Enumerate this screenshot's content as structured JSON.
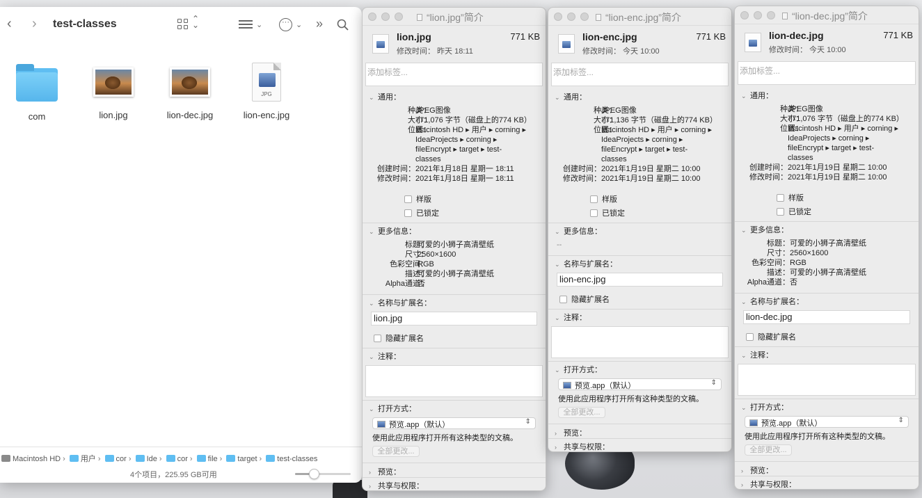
{
  "finder": {
    "title": "test-classes",
    "back_icon": "chevron-left",
    "forward_icon": "chevron-right",
    "more_overflow": "»",
    "search_icon": "magnifier",
    "items": [
      {
        "name": "com",
        "kind": "folder"
      },
      {
        "name": "lion.jpg",
        "kind": "image"
      },
      {
        "name": "lion-dec.jpg",
        "kind": "image"
      },
      {
        "name": "lion-enc.jpg",
        "kind": "jpg-doc",
        "badge": "JPG"
      }
    ],
    "path": [
      "Macintosh HD",
      "用户",
      "cor",
      "Ide",
      "cor",
      "file",
      "target",
      "test-classes"
    ],
    "status": "4个项目，225.95 GB可用",
    "icon_size_slider": 0.3
  },
  "info_windows": [
    {
      "title": "“lion.jpg”简介",
      "name": "lion.jpg",
      "size": "771 KB",
      "modified_short": "修改时间：  昨天 18:11",
      "tags_placeholder": "添加标签...",
      "general_label": "通用：",
      "general": {
        "kind_k": "种类：",
        "kind_v": "JPEG图像",
        "size_k": "大小：",
        "size_v": "771,076 字节（磁盘上的774 KB）",
        "where_k": "位置：",
        "where_v1": "Macintosh HD ▸ 用户 ▸ corning ▸",
        "where_v2": "IdeaProjects ▸ corning ▸",
        "where_v3": "fileEncrypt ▸ target ▸ test-",
        "where_v4": "classes",
        "created_k": "创建时间：",
        "created_v": "2021年1月18日 星期一 18:11",
        "modified_k": "修改时间：",
        "modified_v": "2021年1月18日 星期一 18:11"
      },
      "stationery": "样版",
      "locked": "已锁定",
      "more_info_label": "更多信息：",
      "more_info": {
        "title_k": "标题：",
        "title_v": "可爱的小狮子高清壁纸",
        "dim_k": "尺寸：",
        "dim_v": "2560×1600",
        "color_k": "色彩空间：",
        "color_v": "RGB",
        "desc_k": "描述：",
        "desc_v": "可爱的小狮子高清壁纸",
        "alpha_k": "Alpha通道：",
        "alpha_v": "否"
      },
      "name_ext_label": "名称与扩展名：",
      "name_value": "lion.jpg",
      "hide_ext": "隐藏扩展名",
      "comments_label": "注释：",
      "open_with_label": "打开方式：",
      "open_with_value": "预览.app（默认）",
      "open_with_desc": "使用此应用程序打开所有这种类型的文稿。",
      "change_all": "全部更改...",
      "preview_label": "预览：",
      "sharing_label": "共享与权限："
    },
    {
      "title": "“lion-enc.jpg”简介",
      "name": "lion-enc.jpg",
      "size": "771 KB",
      "modified_short": "修改时间：  今天 10:00",
      "tags_placeholder": "添加标签...",
      "general_label": "通用：",
      "general": {
        "kind_k": "种类：",
        "kind_v": "JPEG图像",
        "size_k": "大小：",
        "size_v": "771,136 字节（磁盘上的774 KB）",
        "where_k": "位置：",
        "where_v1": "Macintosh HD ▸ 用户 ▸ corning ▸",
        "where_v2": "IdeaProjects ▸ corning ▸",
        "where_v3": "fileEncrypt ▸ target ▸ test-",
        "where_v4": "classes",
        "created_k": "创建时间：",
        "created_v": "2021年1月19日 星期二 10:00",
        "modified_k": "修改时间：",
        "modified_v": "2021年1月19日 星期二 10:00"
      },
      "stationery": "样版",
      "locked": "已锁定",
      "more_info_label": "更多信息：",
      "more_info_empty": "--",
      "name_ext_label": "名称与扩展名：",
      "name_value": "lion-enc.jpg",
      "hide_ext": "隐藏扩展名",
      "comments_label": "注释：",
      "open_with_label": "打开方式：",
      "open_with_value": "预览.app（默认）",
      "open_with_desc": "使用此应用程序打开所有这种类型的文稿。",
      "change_all": "全部更改...",
      "preview_label": "预览：",
      "sharing_label": "共享与权限："
    },
    {
      "title": "“lion-dec.jpg”简介",
      "name": "lion-dec.jpg",
      "size": "771 KB",
      "modified_short": "修改时间：  今天 10:00",
      "tags_placeholder": "添加标签...",
      "general_label": "通用：",
      "general": {
        "kind_k": "种类：",
        "kind_v": "JPEG图像",
        "size_k": "大小：",
        "size_v": "771,076 字节（磁盘上的774 KB）",
        "where_k": "位置：",
        "where_v1": "Macintosh HD ▸ 用户 ▸ corning ▸",
        "where_v2": "IdeaProjects ▸ corning ▸",
        "where_v3": "fileEncrypt ▸ target ▸ test-",
        "where_v4": "classes",
        "created_k": "创建时间：",
        "created_v": "2021年1月19日 星期二 10:00",
        "modified_k": "修改时间：",
        "modified_v": "2021年1月19日 星期二 10:00"
      },
      "stationery": "样版",
      "locked": "已锁定",
      "more_info_label": "更多信息：",
      "more_info": {
        "title_k": "标题：",
        "title_v": "可爱的小狮子高清壁纸",
        "dim_k": "尺寸：",
        "dim_v": "2560×1600",
        "color_k": "色彩空间：",
        "color_v": "RGB",
        "desc_k": "描述：",
        "desc_v": "可爱的小狮子高清壁纸",
        "alpha_k": "Alpha通道：",
        "alpha_v": "否"
      },
      "name_ext_label": "名称与扩展名：",
      "name_value": "lion-dec.jpg",
      "hide_ext": "隐藏扩展名",
      "comments_label": "注释：",
      "open_with_label": "打开方式：",
      "open_with_value": "预览.app（默认）",
      "open_with_desc": "使用此应用程序打开所有这种类型的文稿。",
      "change_all": "全部更改...",
      "preview_label": "预览：",
      "sharing_label": "共享与权限："
    }
  ]
}
